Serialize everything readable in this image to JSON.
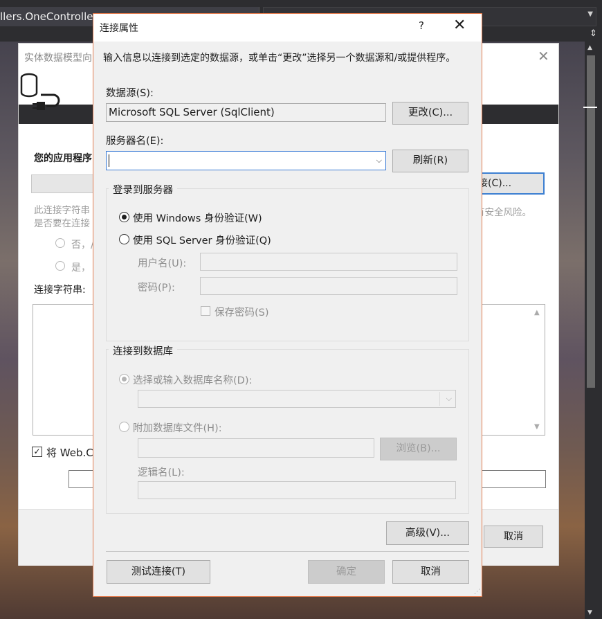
{
  "ide": {
    "tab_title": "llers.OneController",
    "split_glyph": "⇕",
    "scroll_up": "▲",
    "scroll_down": "▼"
  },
  "wizard": {
    "title": "实体数据模型向",
    "close": "✕",
    "question": "您的应用程序",
    "new_connection_button": "接(C)...",
    "sensitive_text": "此连接字符串\n是否要在连接",
    "risk_text": "有安全风险。",
    "radio_no": "否，/",
    "radio_yes": "是，",
    "connstr_label": "连接字符串:",
    "save_check": "✓",
    "save_label": "将 Web.C",
    "cancel_button": "取消"
  },
  "dialog": {
    "title": "连接属性",
    "help": "?",
    "close": "✕",
    "intro": "输入信息以连接到选定的数据源，或单击“更改”选择另一个数据源和/或提供程序。",
    "datasource_label": "数据源(S):",
    "datasource_value": "Microsoft SQL Server (SqlClient)",
    "change_button": "更改(C)...",
    "server_label": "服务器名(E):",
    "server_value": "",
    "refresh_button": "刷新(R)",
    "login_group": "登录到服务器",
    "windows_auth": "使用 Windows 身份验证(W)",
    "sql_auth": "使用 SQL Server 身份验证(Q)",
    "username_label": "用户名(U):",
    "password_label": "密码(P):",
    "save_password": "保存密码(S)",
    "db_group": "连接到数据库",
    "select_db": "选择或输入数据库名称(D):",
    "attach_db": "附加数据库文件(H):",
    "browse_button": "浏览(B)...",
    "logical_name": "逻辑名(L):",
    "advanced_button": "高级(V)...",
    "test_button": "测试连接(T)",
    "ok_button": "确定",
    "cancel_button": "取消"
  },
  "icons": {
    "dropdown": "⌵",
    "grip": "⋰"
  },
  "colors": {
    "accent_focus": "#3a7bd5",
    "dialog_border": "#e27c4f",
    "ide_dark": "#2d2d30"
  }
}
